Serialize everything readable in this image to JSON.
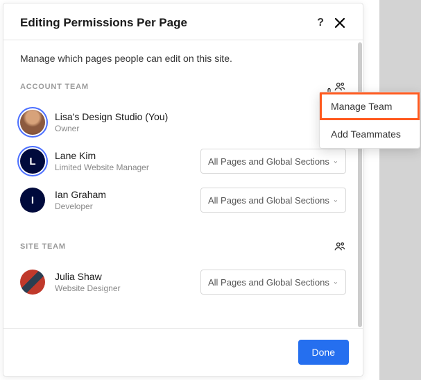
{
  "header": {
    "title": "Editing Permissions Per Page"
  },
  "subtitle": "Manage which pages people can edit on this site.",
  "sections": {
    "account": {
      "label": "ACCOUNT TEAM",
      "members": [
        {
          "name": "Lisa's Design Studio (You)",
          "role": "Owner",
          "perm": null
        },
        {
          "name": "Lane Kim",
          "role": "Limited Website Manager",
          "perm": "All Pages and Global Sections",
          "initial": "L"
        },
        {
          "name": "Ian Graham",
          "role": "Developer",
          "perm": "All Pages and Global Sections",
          "initial": "I"
        }
      ]
    },
    "site": {
      "label": "SITE TEAM",
      "members": [
        {
          "name": "Julia Shaw",
          "role": "Website Designer",
          "perm": "All Pages and Global Sections"
        }
      ]
    }
  },
  "popover": {
    "manage": "Manage Team",
    "add": "Add Teammates"
  },
  "footer": {
    "done": "Done"
  }
}
